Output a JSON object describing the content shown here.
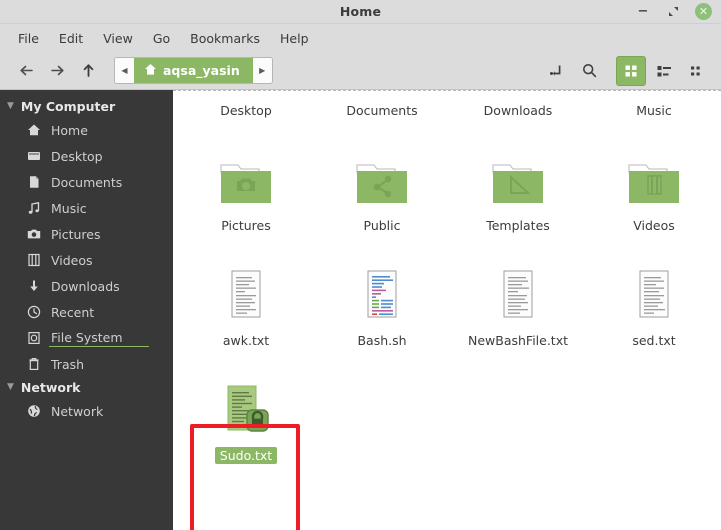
{
  "window": {
    "title": "Home",
    "controls": {
      "minimize": "minimize-button",
      "maximize": "maximize-button",
      "close": "close-button"
    }
  },
  "menubar": {
    "items": [
      {
        "label": "File"
      },
      {
        "label": "Edit"
      },
      {
        "label": "View"
      },
      {
        "label": "Go"
      },
      {
        "label": "Bookmarks"
      },
      {
        "label": "Help"
      }
    ]
  },
  "toolbar": {
    "back": "back-arrow-icon",
    "forward": "forward-arrow-icon",
    "up": "up-arrow-icon",
    "path_prev": "◀",
    "path_next": "▶",
    "breadcrumb": "aqsa_yasin",
    "toggle_location_entry": "location-entry-icon",
    "search": "search-icon",
    "view_icon": "icon-view-button",
    "view_list": "list-view-button",
    "view_compact": "compact-view-button"
  },
  "sidebar": {
    "sections": [
      {
        "label": "My Computer",
        "items": [
          {
            "label": "Home",
            "icon": "home-icon"
          },
          {
            "label": "Desktop",
            "icon": "desktop-icon"
          },
          {
            "label": "Documents",
            "icon": "document-icon"
          },
          {
            "label": "Music",
            "icon": "music-note-icon"
          },
          {
            "label": "Pictures",
            "icon": "camera-icon"
          },
          {
            "label": "Videos",
            "icon": "film-icon"
          },
          {
            "label": "Downloads",
            "icon": "download-arrow-icon"
          },
          {
            "label": "Recent",
            "icon": "clock-icon"
          },
          {
            "label": "File System",
            "icon": "drive-icon",
            "hovered": true
          },
          {
            "label": "Trash",
            "icon": "trash-icon"
          }
        ]
      },
      {
        "label": "Network",
        "items": [
          {
            "label": "Network",
            "icon": "globe-icon"
          }
        ]
      }
    ]
  },
  "files": [
    {
      "name": "Desktop",
      "type": "folder",
      "glyph": "desktop-folder-icon",
      "selected": false
    },
    {
      "name": "Documents",
      "type": "folder",
      "glyph": "documents-folder-icon",
      "selected": false
    },
    {
      "name": "Downloads",
      "type": "folder",
      "glyph": "downloads-folder-icon",
      "selected": false
    },
    {
      "name": "Music",
      "type": "folder",
      "glyph": "music-folder-icon",
      "selected": false
    },
    {
      "name": "Pictures",
      "type": "folder",
      "glyph": "pictures-folder-icon",
      "selected": false
    },
    {
      "name": "Public",
      "type": "folder",
      "glyph": "public-folder-icon",
      "selected": false
    },
    {
      "name": "Templates",
      "type": "folder",
      "glyph": "templates-folder-icon",
      "selected": false
    },
    {
      "name": "Videos",
      "type": "folder",
      "glyph": "videos-folder-icon",
      "selected": false
    },
    {
      "name": "awk.txt",
      "type": "text",
      "glyph": "text-file-icon",
      "selected": false
    },
    {
      "name": "Bash.sh",
      "type": "script",
      "glyph": "script-file-icon",
      "selected": false
    },
    {
      "name": "NewBashFile.txt",
      "type": "text",
      "glyph": "text-file-icon",
      "selected": false
    },
    {
      "name": "sed.txt",
      "type": "text",
      "glyph": "text-file-icon",
      "selected": false
    },
    {
      "name": "Sudo.txt",
      "type": "locked",
      "glyph": "locked-file-icon",
      "selected": true
    }
  ],
  "annotation": {
    "highlight_target": "Sudo.txt",
    "color": "#ee1c25"
  },
  "colors": {
    "accent_green": "#8cb866",
    "folder_green": "#8cb866",
    "sidebar_bg": "#383838",
    "chrome_bg": "#dcdcdc",
    "highlight_red": "#ee1c25"
  }
}
